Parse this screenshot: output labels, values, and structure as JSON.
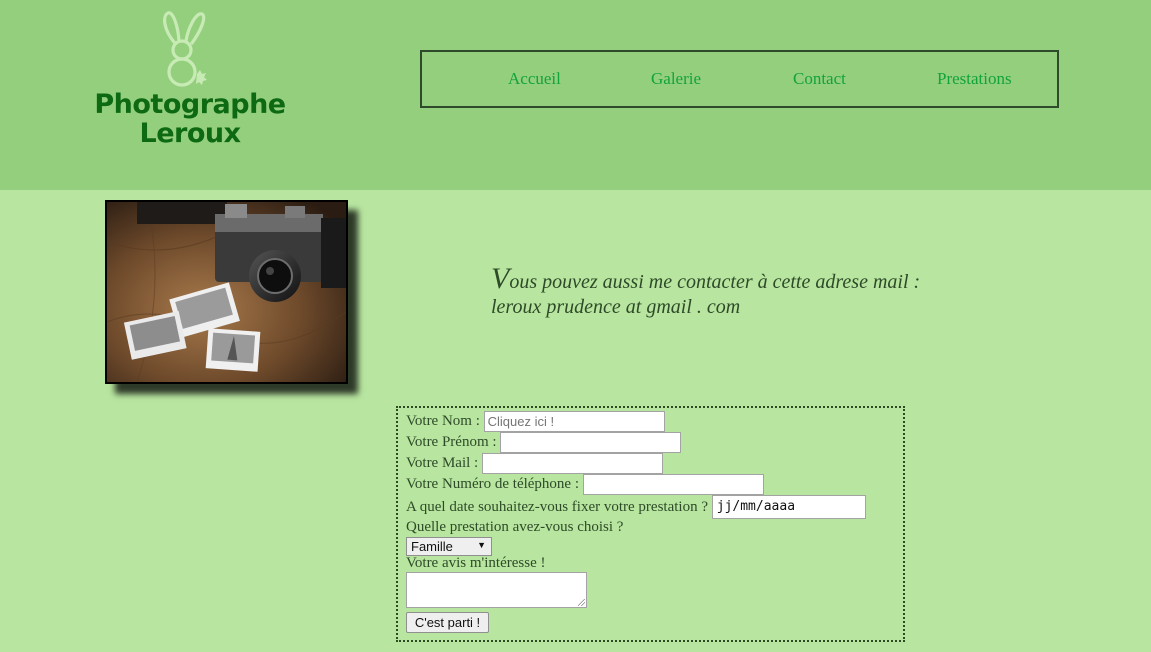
{
  "header": {
    "logo": {
      "line1": "Photographe",
      "line2": "Leroux"
    },
    "nav": [
      {
        "label": "Accueil"
      },
      {
        "label": "Galerie"
      },
      {
        "label": "Contact"
      },
      {
        "label": "Prestations"
      }
    ]
  },
  "contact": {
    "dropcap": "V",
    "line1_rest": "ous pouvez aussi me contacter à cette adrese mail :",
    "line2": "leroux prudence at gmail . com"
  },
  "form": {
    "nom": {
      "label": "Votre Nom :",
      "placeholder": "Cliquez ici !",
      "value": ""
    },
    "prenom": {
      "label": "Votre Prénom :",
      "value": ""
    },
    "mail": {
      "label": "Votre Mail :",
      "value": ""
    },
    "tel": {
      "label": "Votre Numéro de téléphone :",
      "value": ""
    },
    "date": {
      "label": "A quel date souhaitez-vous fixer votre prestation ?",
      "value": "jj/mm/aaaa"
    },
    "prestation": {
      "label": "Quelle prestation avez-vous choisi ?",
      "selected": "Famille"
    },
    "avis": {
      "label": "Votre avis m'intéresse !",
      "value": ""
    },
    "submit_label": "C'est parti !"
  },
  "colors": {
    "header_bg": "#94cf7e",
    "page_bg": "#b8e6a0",
    "logo_text": "#0d6a12",
    "nav_link": "#12a33a"
  },
  "icons": {
    "logo": "rabbit-icon",
    "select_arrow": "triangle-down-icon",
    "resize_grip": "resize-grip-icon"
  }
}
